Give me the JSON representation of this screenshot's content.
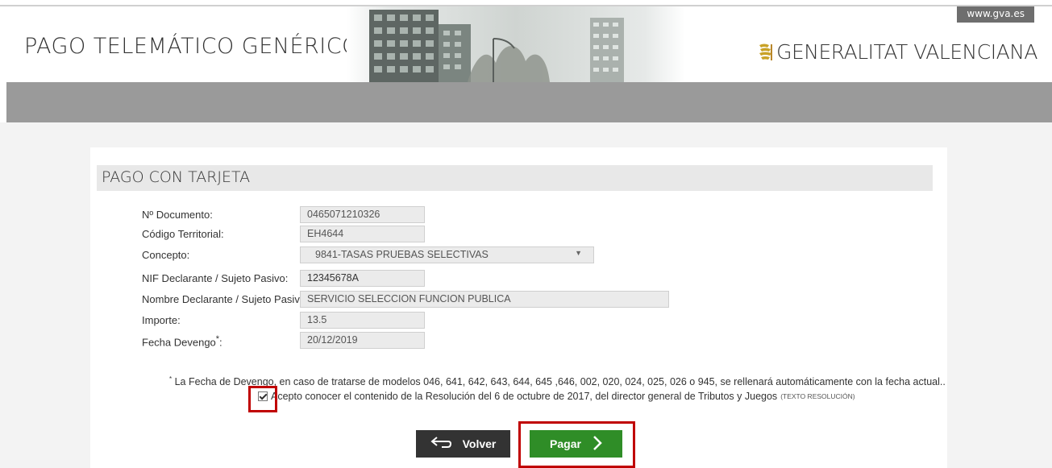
{
  "header": {
    "site_title": "PAGO TELEMÁTICO GENÉRICO",
    "gva_link": "www.gva.es",
    "brand": "GENERALITAT VALENCIANA"
  },
  "section": {
    "title": "PAGO CON TARJETA"
  },
  "form": {
    "documento": {
      "label": "Nº Documento:",
      "value": "0465071210326"
    },
    "codigo": {
      "label": "Código Territorial:",
      "value": "EH4644"
    },
    "concepto": {
      "label": "Concepto:",
      "value": "9841-TASAS PRUEBAS SELECTIVAS"
    },
    "nif": {
      "label": "NIF Declarante / Sujeto Pasivo:",
      "value": "12345678A"
    },
    "nombre": {
      "label": "Nombre Declarante / Sujeto Pasivo:",
      "value": "SERVICIO SELECCION FUNCION PUBLICA"
    },
    "importe": {
      "label": "Importe:",
      "value": "13.5"
    },
    "fecha": {
      "label": "Fecha Devengo",
      "label_suffix": ":",
      "value": "20/12/2019"
    }
  },
  "note": {
    "marker": "*",
    "text": "La Fecha de Devengo, en caso de tratarse de modelos 046, 641, 642, 643, 644, 645 ,646, 002, 020, 024, 025, 026 o 945, se rellenará automáticamente con la fecha actual.."
  },
  "accept": {
    "checked": true,
    "text": "Acepto conocer el contenido de la Resolución del 6 de octubre de 2017, del director general de Tributos y Juegos",
    "link": "(TEXTO RESOLUCIÓN)"
  },
  "buttons": {
    "volver": "Volver",
    "pagar": "Pagar"
  },
  "colors": {
    "pagar": "#2f8d27",
    "volver": "#333333",
    "highlight": "#c00000"
  }
}
